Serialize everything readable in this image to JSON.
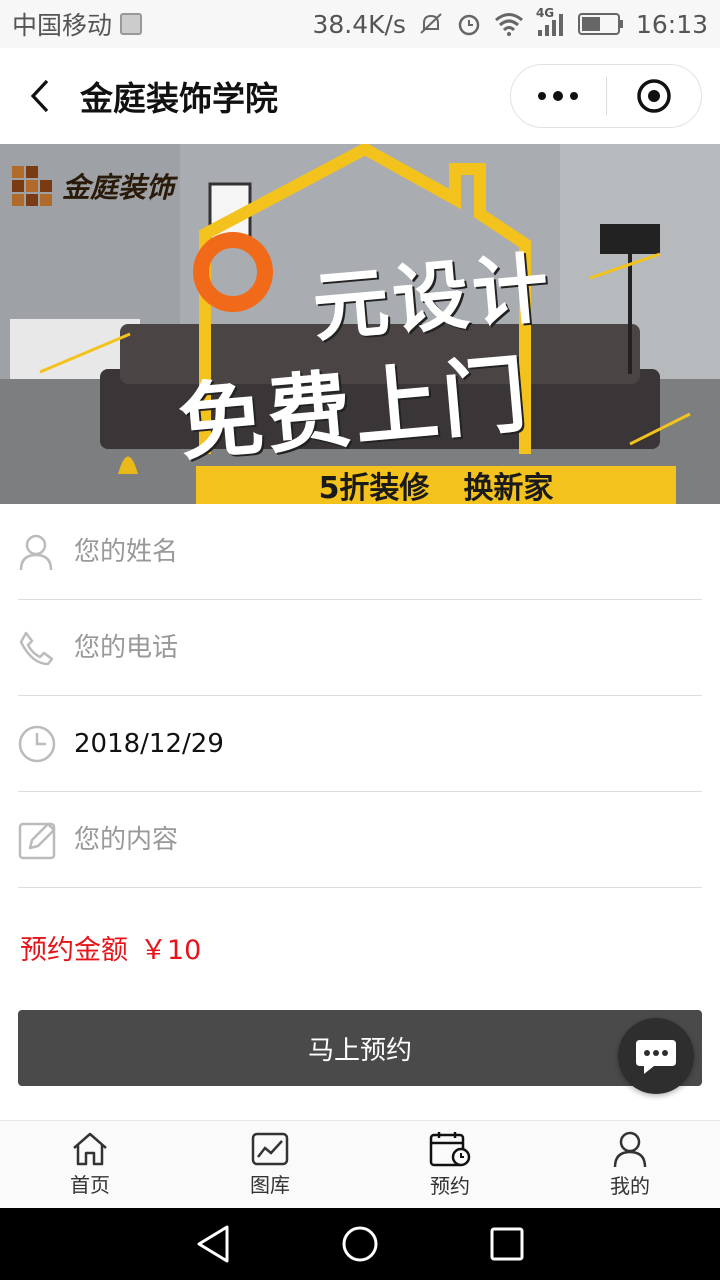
{
  "status_bar": {
    "carrier": "中国移动",
    "network_speed": "38.4K/s",
    "network_type": "4G",
    "time": "16:13"
  },
  "navbar": {
    "title": "金庭装饰学院"
  },
  "banner": {
    "logo_text": "金庭装饰",
    "headline_1": "元设计",
    "headline_2": "免费上门",
    "sub_1": "5折装修",
    "sub_2": "换新家",
    "accent_color": "#f3c21c",
    "zero_color": "#f06a1a"
  },
  "form": {
    "name_placeholder": "您的姓名",
    "phone_placeholder": "您的电话",
    "date_value": "2018/12/29",
    "content_placeholder": "您的内容"
  },
  "price": {
    "label": "预约金额",
    "value": "￥10",
    "color": "#e5141a"
  },
  "submit_label": "马上预约",
  "tabs": [
    {
      "label": "首页",
      "icon": "home-icon"
    },
    {
      "label": "图库",
      "icon": "gallery-icon"
    },
    {
      "label": "预约",
      "icon": "calendar-icon"
    },
    {
      "label": "我的",
      "icon": "user-icon"
    }
  ]
}
